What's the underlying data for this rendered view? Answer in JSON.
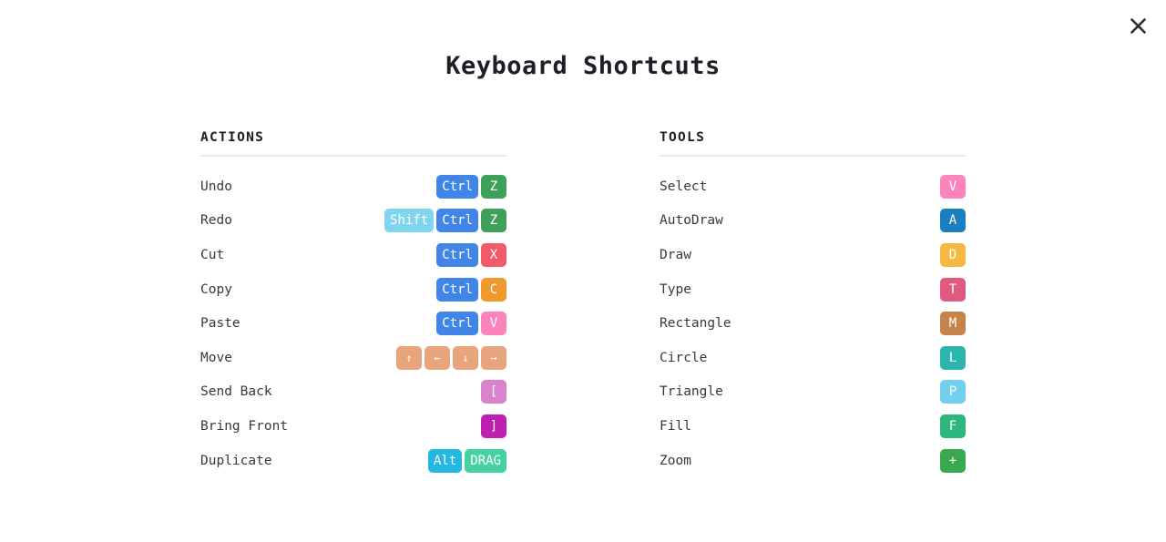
{
  "window": {
    "title": "Keyboard Shortcuts",
    "close_icon": "close-icon"
  },
  "columns": [
    {
      "id": "actions",
      "header": "ACTIONS",
      "rows": [
        {
          "label": "Undo",
          "keys": [
            {
              "text": "Ctrl",
              "color": "#4285e8"
            },
            {
              "text": "Z",
              "color": "#3fa05a"
            }
          ]
        },
        {
          "label": "Redo",
          "keys": [
            {
              "text": "Shift",
              "color": "#7fd4ee"
            },
            {
              "text": "Ctrl",
              "color": "#4285e8"
            },
            {
              "text": "Z",
              "color": "#3fa05a"
            }
          ]
        },
        {
          "label": "Cut",
          "keys": [
            {
              "text": "Ctrl",
              "color": "#4285e8"
            },
            {
              "text": "X",
              "color": "#f2596b"
            }
          ]
        },
        {
          "label": "Copy",
          "keys": [
            {
              "text": "Ctrl",
              "color": "#4285e8"
            },
            {
              "text": "C",
              "color": "#f0992e"
            }
          ]
        },
        {
          "label": "Paste",
          "keys": [
            {
              "text": "Ctrl",
              "color": "#4285e8"
            },
            {
              "text": "V",
              "color": "#fa84bb"
            }
          ]
        },
        {
          "label": "Move",
          "keys": [
            {
              "text": "↑",
              "color": "#e8a47c"
            },
            {
              "text": "←",
              "color": "#e8a47c"
            },
            {
              "text": "↓",
              "color": "#e8a47c"
            },
            {
              "text": "→",
              "color": "#e8a47c"
            }
          ]
        },
        {
          "label": "Send Back",
          "keys": [
            {
              "text": "[",
              "color": "#d983cc"
            }
          ]
        },
        {
          "label": "Bring Front",
          "keys": [
            {
              "text": "]",
              "color": "#c020b0"
            }
          ]
        },
        {
          "label": "Duplicate",
          "keys": [
            {
              "text": "Alt",
              "color": "#22b8e0"
            },
            {
              "text": "DRAG",
              "color": "#48d1a0"
            }
          ]
        }
      ]
    },
    {
      "id": "tools",
      "header": "TOOLS",
      "rows": [
        {
          "label": "Select",
          "keys": [
            {
              "text": "V",
              "color": "#fa84bb"
            }
          ]
        },
        {
          "label": "AutoDraw",
          "keys": [
            {
              "text": "A",
              "color": "#1a7fc0"
            }
          ]
        },
        {
          "label": "Draw",
          "keys": [
            {
              "text": "D",
              "color": "#f5b942"
            }
          ]
        },
        {
          "label": "Type",
          "keys": [
            {
              "text": "T",
              "color": "#e05a80"
            }
          ]
        },
        {
          "label": "Rectangle",
          "keys": [
            {
              "text": "M",
              "color": "#c8834a"
            }
          ]
        },
        {
          "label": "Circle",
          "keys": [
            {
              "text": "L",
              "color": "#2bb5ae"
            }
          ]
        },
        {
          "label": "Triangle",
          "keys": [
            {
              "text": "P",
              "color": "#72cfee"
            }
          ]
        },
        {
          "label": "Fill",
          "keys": [
            {
              "text": "F",
              "color": "#2bb87a"
            }
          ]
        },
        {
          "label": "Zoom",
          "keys": [
            {
              "text": "+",
              "color": "#3aa84f"
            }
          ]
        }
      ]
    }
  ]
}
